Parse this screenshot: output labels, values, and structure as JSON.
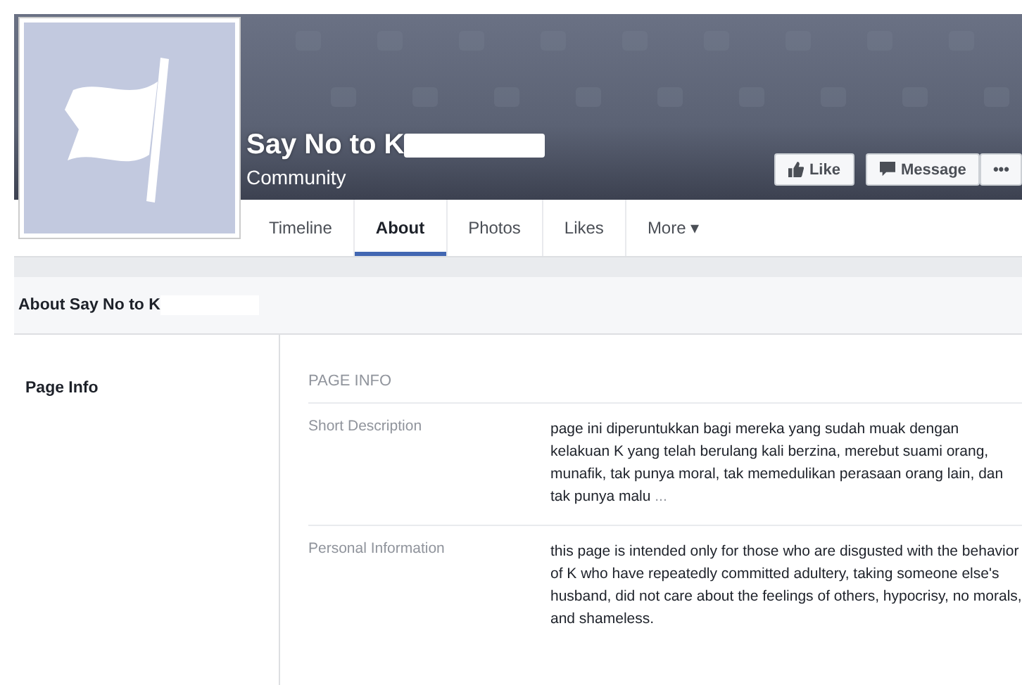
{
  "header": {
    "title": "Say No to K",
    "redacted": true,
    "category": "Community",
    "buttons": [
      {
        "kind": "like",
        "label": "Like"
      },
      {
        "kind": "message",
        "label": "Message"
      },
      {
        "kind": "more",
        "label": "•••"
      }
    ]
  },
  "tabs": [
    {
      "label": "Timeline",
      "selected": false
    },
    {
      "label": "About",
      "selected": true
    },
    {
      "label": "Photos",
      "selected": false
    },
    {
      "label": "Likes",
      "selected": false
    },
    {
      "label": "More ▾",
      "selected": false
    }
  ],
  "about": {
    "heading": "About Say No to K",
    "redacted": true,
    "sidebar": [
      {
        "label": "Page Info",
        "selected": true
      }
    ],
    "section_title": "PAGE INFO",
    "rows": [
      {
        "label": "Short Description",
        "value": "page ini diperuntukkan bagi mereka yang sudah muak dengan kelakuan K yang telah berulang kali berzina, merebut suami orang, munafik, tak punya moral, tak memedulikan perasaan orang lain, dan tak punya malu",
        "more": "..."
      },
      {
        "label": "Personal Information",
        "value": "this page is intended only for those who are disgusted with the behavior of K who have repeatedly committed adultery, taking someone else's husband, did not care about the feelings of others, hypocrisy, no morals, and shameless."
      }
    ]
  }
}
